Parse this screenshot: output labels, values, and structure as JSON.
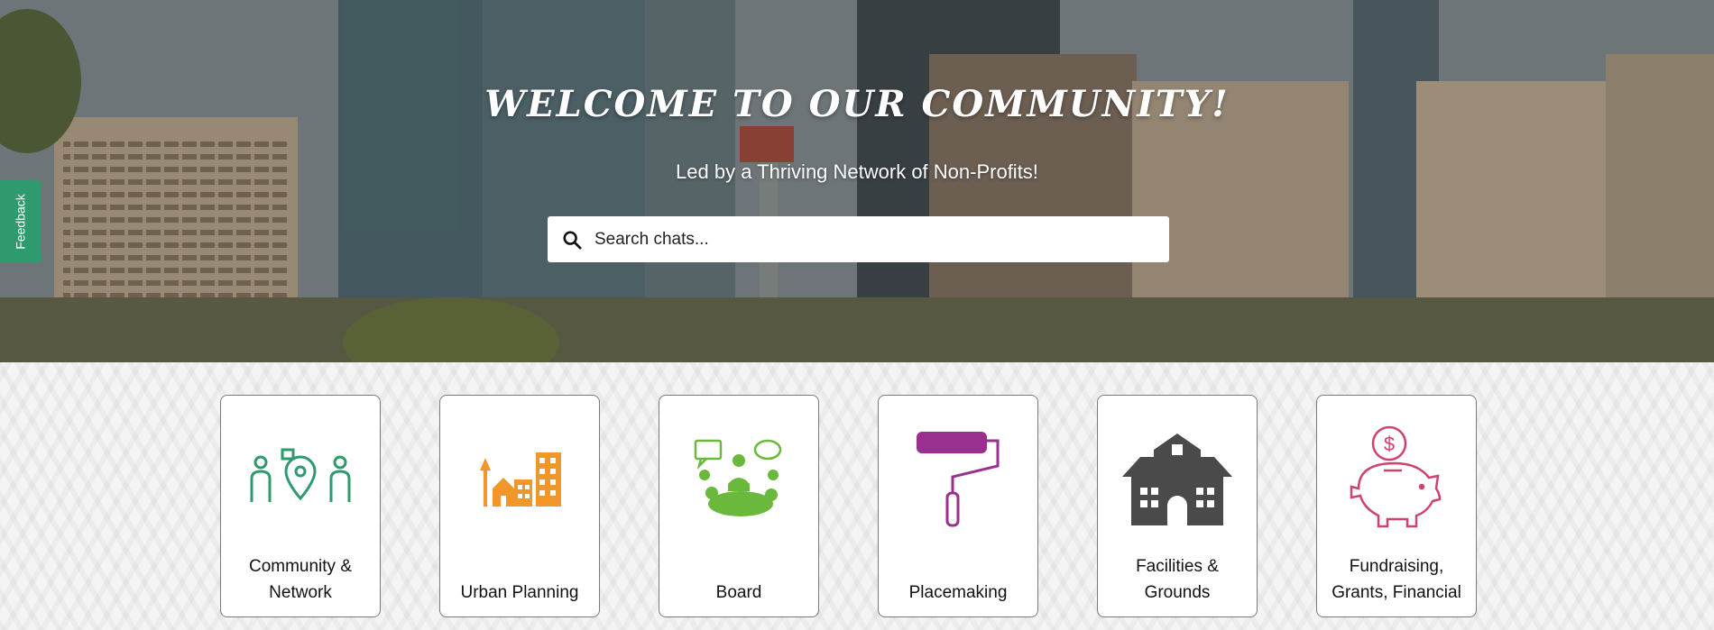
{
  "hero": {
    "title": "Welcome to our community!",
    "subtitle": "Led by a Thriving Network of Non-Profits!"
  },
  "search": {
    "placeholder": "Search chats...",
    "value": "",
    "icon": "search-icon"
  },
  "feedback": {
    "label": "Feedback",
    "color": "#2e9a6e"
  },
  "categories": [
    {
      "label": "Community & Network",
      "icon": "community-network-icon",
      "color": "#2e9a6e"
    },
    {
      "label": "Urban Planning",
      "icon": "city-buildings-icon",
      "color": "#f0962a"
    },
    {
      "label": "Board",
      "icon": "board-meeting-icon",
      "color": "#6ab83c"
    },
    {
      "label": "Placemaking",
      "icon": "paint-roller-icon",
      "color": "#9b2f8f"
    },
    {
      "label": "Facilities & Grounds",
      "icon": "school-building-icon",
      "color": "#4a4a4a"
    },
    {
      "label": "Fundraising, Grants, Financial",
      "icon": "piggy-bank-icon",
      "color": "#d1426b"
    }
  ]
}
